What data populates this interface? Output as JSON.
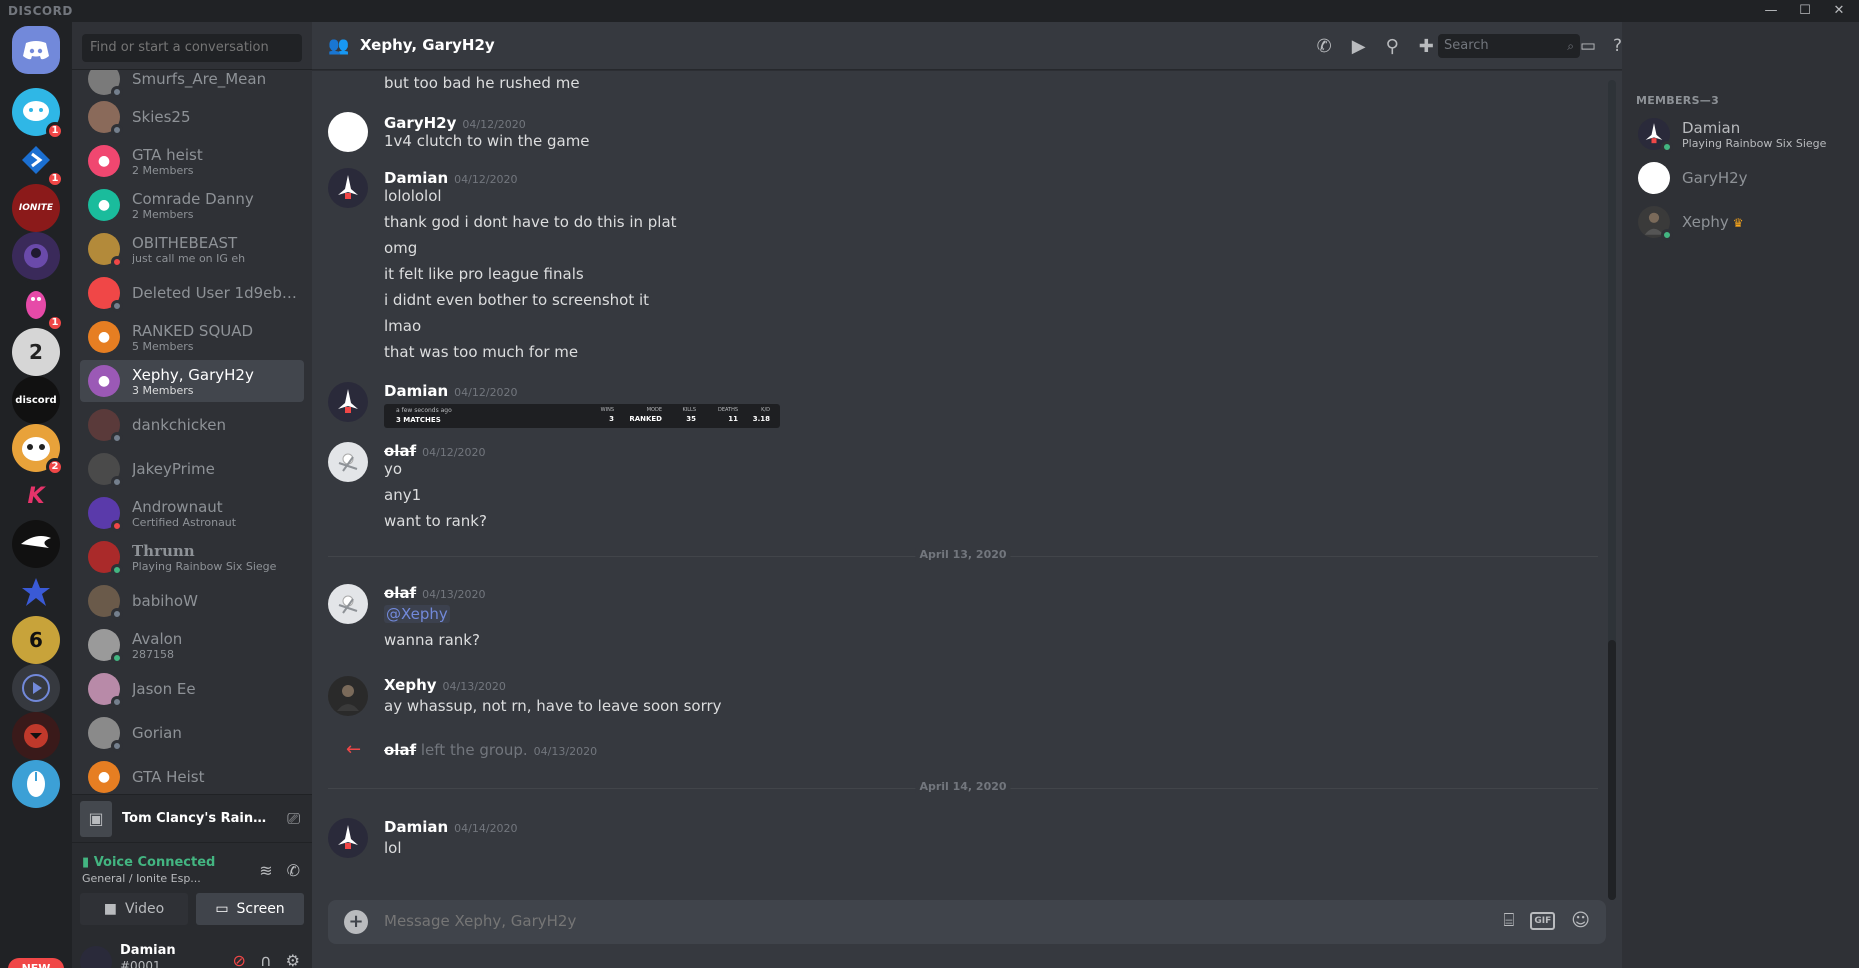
{
  "app": {
    "brand": "DISCORD"
  },
  "window_controls": {
    "minimize": "—",
    "maximize": "☐",
    "close": "✕"
  },
  "colors": {
    "online": "#43b581",
    "dnd": "#f04747",
    "offline": "#747f8d",
    "mention_badge": "#f04747",
    "accent": "#7289da"
  },
  "guilds": {
    "home_icon": "discord-logo-icon",
    "items": [
      {
        "icon": "chat-bubble-server-icon",
        "badge": "1",
        "color": "#2fb7e6"
      },
      {
        "icon": "blue-arrow-server-icon",
        "badge": "1",
        "color": "#1b6fd1"
      },
      {
        "icon": "ionite-esports-server-icon",
        "badge": "",
        "color": "#8b1a1a"
      },
      {
        "icon": "purple-character-server-icon",
        "badge": "",
        "color": "#3a2a5a"
      },
      {
        "icon": "pink-character-server-icon",
        "badge": "1",
        "color": "#202225"
      },
      {
        "icon": "number-two-server-icon",
        "badge": "",
        "color": "#d6d6d6"
      },
      {
        "icon": "discord-bio-server-icon",
        "badge": "",
        "label": "discord",
        "color": "#1a1a1a"
      },
      {
        "icon": "cartoon-face-server-icon",
        "badge": "2",
        "color": "#e8a23a"
      },
      {
        "icon": "fk-logo-server-icon",
        "badge": "",
        "color": "#202225"
      },
      {
        "icon": "white-wing-server-icon",
        "badge": "",
        "color": "#111"
      },
      {
        "icon": "blue-star-server-icon",
        "badge": "",
        "color": "#202225"
      },
      {
        "icon": "r6-siege-server-icon",
        "badge": "",
        "color": "#c8a33a"
      },
      {
        "icon": "play-button-server-icon",
        "badge": "",
        "color": "#36393f"
      },
      {
        "icon": "red-character-server-icon",
        "badge": "",
        "color": "#3a1a1a"
      },
      {
        "icon": "mouse-server-icon",
        "badge": "",
        "color": "#3ca0d6"
      }
    ],
    "new_badge": "NEW"
  },
  "sidebar": {
    "search_placeholder": "Find or start a conversation",
    "items": [
      {
        "name": "Smurfs_Are_Mean",
        "sub": "",
        "status": "offline",
        "color": "#7a7a7a"
      },
      {
        "name": "Skies25",
        "sub": "",
        "status": "offline",
        "color": "#8a6a5a"
      },
      {
        "name": "GTA heist",
        "sub": "2 Members",
        "status": "",
        "color": "#f04770"
      },
      {
        "name": "Comrade Danny",
        "sub": "2 Members",
        "status": "",
        "color": "#1abc9c"
      },
      {
        "name": "OBITHEBEAST",
        "sub": "just call me on IG eh",
        "status": "dnd",
        "color": "#b38a3a"
      },
      {
        "name": "Deleted User 1d9eb0...",
        "sub": "",
        "status": "offline",
        "color": "#f04747"
      },
      {
        "name": "RANKED SQUAD",
        "sub": "5 Members",
        "status": "",
        "color": "#e67e22"
      },
      {
        "name": "Xephy, GaryH2y",
        "sub": "3 Members",
        "status": "",
        "color": "#9b59b6"
      },
      {
        "name": "dankchicken",
        "sub": "",
        "status": "offline",
        "color": "#5a3a3a"
      },
      {
        "name": "JakeyPrime",
        "sub": "",
        "status": "offline",
        "color": "#4a4a4a"
      },
      {
        "name": "Andrownaut",
        "sub": "Certified Astronaut",
        "status": "dnd",
        "color": "#5a3aaa"
      },
      {
        "name": "Thrunn",
        "sub": "Playing Rainbow Six Siege",
        "status": "online",
        "color": "#aa2a2a"
      },
      {
        "name": "babihoW",
        "sub": "",
        "status": "offline",
        "color": "#6a5a4a"
      },
      {
        "name": "Avalon",
        "sub": "287158",
        "status": "online",
        "color": "#9a9a9a"
      },
      {
        "name": "Jason Ee",
        "sub": "",
        "status": "offline",
        "color": "#b88aa8"
      },
      {
        "name": "Gorian",
        "sub": "",
        "status": "offline",
        "color": "#8a8a8a"
      },
      {
        "name": "GTA Heist",
        "sub": "",
        "status": "",
        "color": "#e67e22"
      }
    ]
  },
  "activity": {
    "game": "Tom Clancy's Rainbow ...",
    "icon": "game-controller-icon"
  },
  "voice": {
    "status": "Voice Connected",
    "channel": "General / ",
    "server": "Ionite Esp...",
    "video_label": "Video",
    "screen_label": "Screen"
  },
  "user": {
    "name": "Damian",
    "tag": "#0001"
  },
  "chat": {
    "title": "Xephy, GaryH2y",
    "composer_placeholder": "Message Xephy, GaryH2y",
    "search_placeholder": "Search"
  },
  "messages": {
    "m0": {
      "line": "but too bad he rushed me"
    },
    "m1": {
      "author": "GaryH2y",
      "time": "04/12/2020",
      "lines": [
        "1v4 clutch to win the game"
      ]
    },
    "m2": {
      "author": "Damian",
      "time": "04/12/2020",
      "lines": [
        "lolololol",
        "thank god i dont have to do this in plat",
        "omg",
        "it felt like pro league finals",
        "i didnt even bother to screenshot it",
        "lmao",
        "that was too much for me"
      ]
    },
    "m3": {
      "author": "Damian",
      "time": "04/12/2020",
      "embed": {
        "ago": "a few seconds ago",
        "matches": "3 MATCHES",
        "cols": [
          {
            "h": "WINS",
            "v": "3"
          },
          {
            "h": "MODE",
            "v": "RANKED"
          },
          {
            "h": "KILLS",
            "v": "35"
          },
          {
            "h": "DEATHS",
            "v": "11"
          },
          {
            "h": "K/D",
            "v": "3.18"
          }
        ]
      }
    },
    "m4": {
      "author": "olaf",
      "time": "04/12/2020",
      "lines": [
        "yo",
        "any1",
        "want to rank?"
      ]
    },
    "div1": "April 13, 2020",
    "m5": {
      "author": "olaf",
      "time": "04/13/2020",
      "mention": "@Xephy",
      "lines": [
        "wanna rank?"
      ]
    },
    "m6": {
      "author": "Xephy",
      "time": "04/13/2020",
      "lines": [
        "ay whassup, not rn, have to leave soon sorry"
      ]
    },
    "m7": {
      "author": "olaf",
      "text": "left the group.",
      "time": "04/13/2020"
    },
    "div2": "April 14, 2020",
    "m8": {
      "author": "Damian",
      "time": "04/14/2020",
      "lines": [
        "lol"
      ]
    }
  },
  "members": {
    "header": "MEMBERS—3",
    "items": [
      {
        "name": "Damian",
        "sub": "Playing Rainbow Six Siege",
        "status": "online",
        "color": "#2a2a3a"
      },
      {
        "name": "GaryH2y",
        "sub": "",
        "status": "",
        "color": "#ffffff"
      },
      {
        "name": "Xephy",
        "sub": "",
        "status": "online",
        "color": "#3a3a3a",
        "owner": "crown-icon"
      }
    ]
  }
}
